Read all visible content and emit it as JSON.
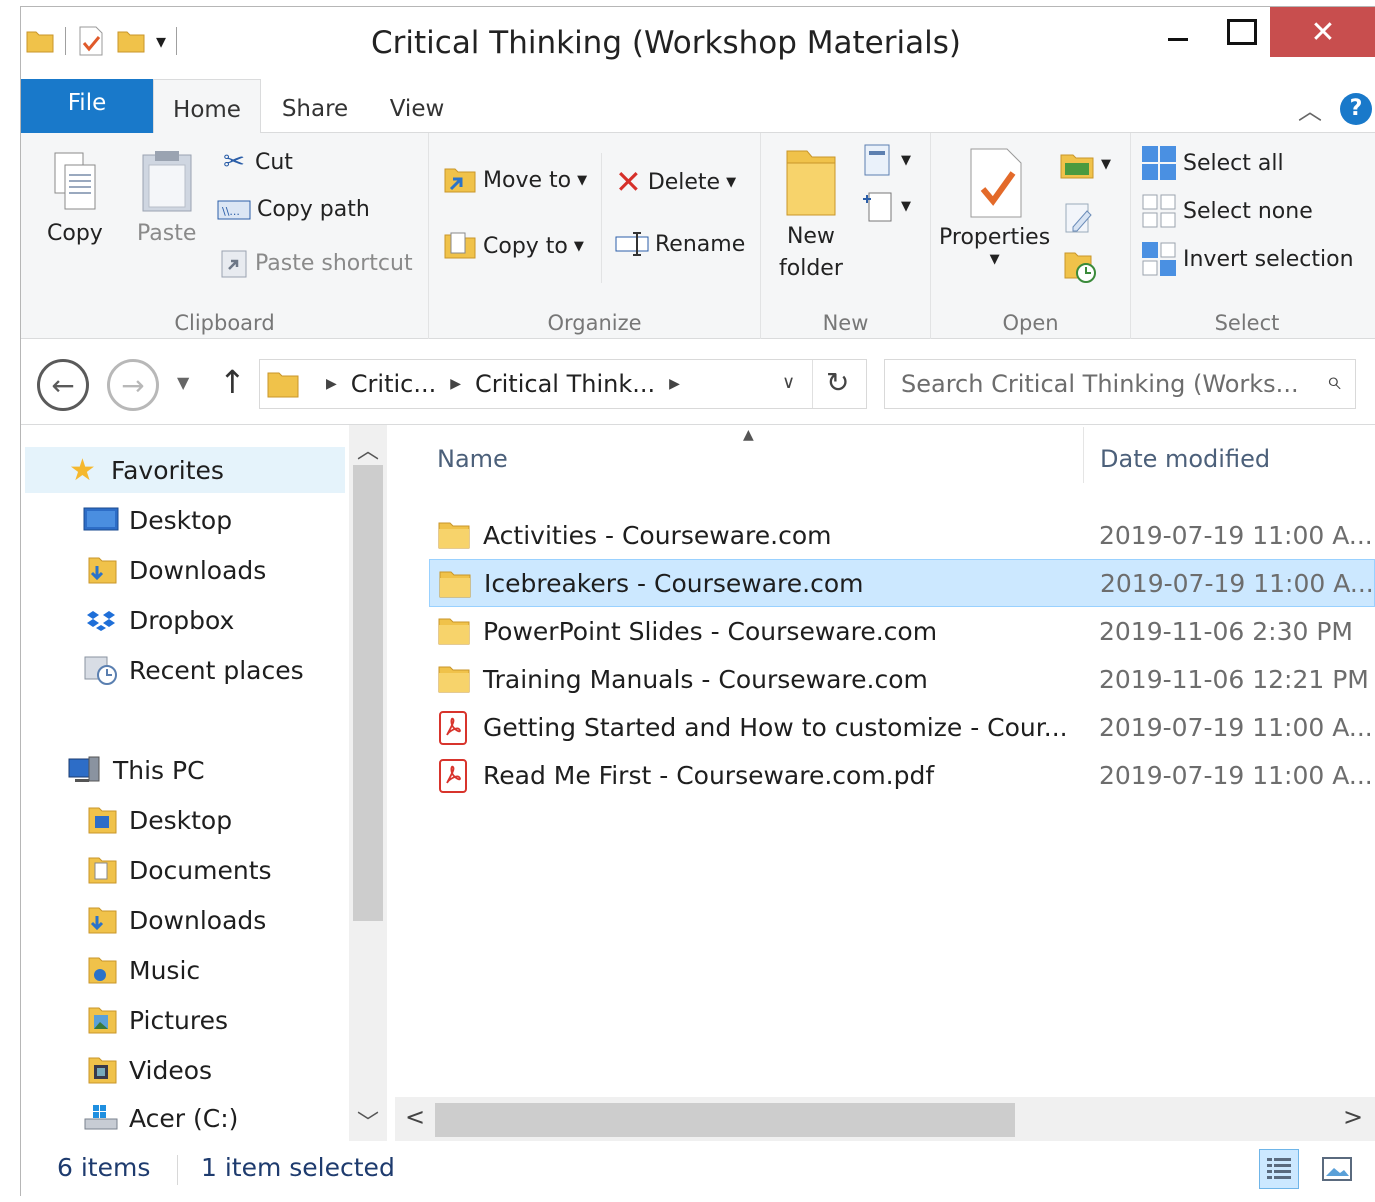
{
  "window": {
    "title": "Critical Thinking (Workshop Materials)",
    "close_glyph": "✕"
  },
  "ribbon_tabs": {
    "file": "File",
    "home": "Home",
    "share": "Share",
    "view": "View"
  },
  "ribbon": {
    "clipboard": {
      "label": "Clipboard",
      "copy": "Copy",
      "paste": "Paste",
      "cut": "Cut",
      "copy_path": "Copy path",
      "paste_shortcut": "Paste shortcut"
    },
    "organize": {
      "label": "Organize",
      "move_to": "Move to",
      "copy_to": "Copy to",
      "delete": "Delete",
      "rename": "Rename"
    },
    "new": {
      "label": "New",
      "new_folder_line1": "New",
      "new_folder_line2": "folder"
    },
    "open": {
      "label": "Open",
      "properties": "Properties"
    },
    "select": {
      "label": "Select",
      "select_all": "Select all",
      "select_none": "Select none",
      "invert_selection": "Invert selection"
    }
  },
  "address": {
    "crumbs": [
      "Critic...",
      "Critical Think..."
    ],
    "search_placeholder": "Search Critical Thinking (Works..."
  },
  "nav_pane": {
    "favorites": "Favorites",
    "favorites_items": [
      "Desktop",
      "Downloads",
      "Dropbox",
      "Recent places"
    ],
    "this_pc": "This PC",
    "pc_items": [
      "Desktop",
      "Documents",
      "Downloads",
      "Music",
      "Pictures",
      "Videos",
      "Acer (C:)"
    ]
  },
  "columns": {
    "name": "Name",
    "date_modified": "Date modified"
  },
  "files": [
    {
      "name": "Activities - Courseware.com",
      "date": "2019-07-19 11:00 A...",
      "icon": "folder-icon",
      "selected": false
    },
    {
      "name": "Icebreakers - Courseware.com",
      "date": "2019-07-19 11:00 A...",
      "icon": "folder-icon",
      "selected": true
    },
    {
      "name": "PowerPoint Slides - Courseware.com",
      "date": "2019-11-06 2:30 PM",
      "icon": "folder-icon",
      "selected": false
    },
    {
      "name": "Training Manuals - Courseware.com",
      "date": "2019-11-06 12:21 PM",
      "icon": "folder-icon",
      "selected": false
    },
    {
      "name": "Getting Started and How to customize - Cour...",
      "date": "2019-07-19 11:00 A...",
      "icon": "pdf-icon",
      "selected": false
    },
    {
      "name": "Read Me First - Courseware.com.pdf",
      "date": "2019-07-19 11:00 A...",
      "icon": "pdf-icon",
      "selected": false
    }
  ],
  "status": {
    "item_count": "6 items",
    "selection": "1 item selected"
  },
  "colors": {
    "accent": "#1979ca",
    "close_button": "#c84e4e",
    "selection": "#cce8ff"
  }
}
